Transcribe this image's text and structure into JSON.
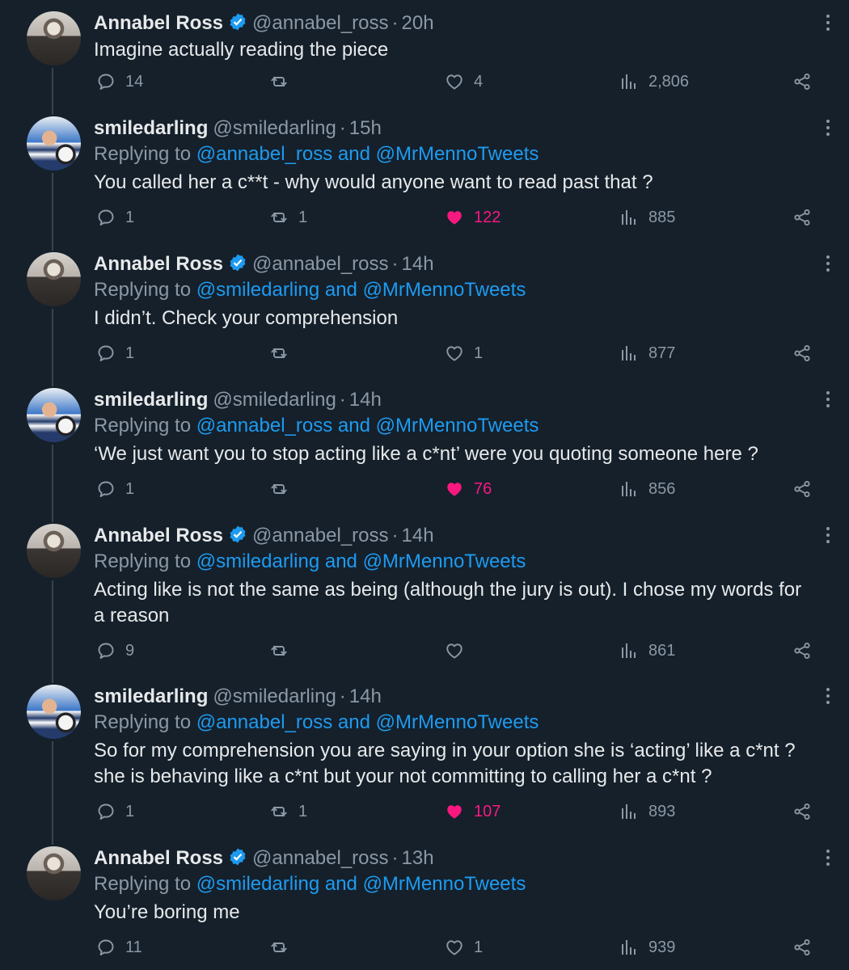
{
  "tweets": [
    {
      "name": "Annabel Ross",
      "verified": true,
      "handle": "@annabel_ross",
      "time": "20h",
      "replying_label": "",
      "replying_to": [],
      "replying_joiner": "",
      "text": [
        "Imagine actually reading the piece"
      ],
      "replies": "14",
      "retweets": "",
      "likes": "4",
      "liked": false,
      "views": "2,806",
      "avatar": "ar",
      "thread_line": "below"
    },
    {
      "name": "smiledarling",
      "verified": false,
      "handle": "@smiledarling",
      "time": "15h",
      "replying_label": "Replying to",
      "replying_to": [
        "@annabel_ross",
        "@MrMennoTweets"
      ],
      "replying_joiner": "and",
      "text": [
        "You called her a c**t - why would anyone want to read past that ?"
      ],
      "replies": "1",
      "retweets": "1",
      "likes": "122",
      "liked": true,
      "views": "885",
      "avatar": "sd",
      "thread_line": "both"
    },
    {
      "name": "Annabel Ross",
      "verified": true,
      "handle": "@annabel_ross",
      "time": "14h",
      "replying_label": "Replying to",
      "replying_to": [
        "@smiledarling",
        "@MrMennoTweets"
      ],
      "replying_joiner": "and",
      "text": [
        "I didn’t. Check your comprehension"
      ],
      "replies": "1",
      "retweets": "",
      "likes": "1",
      "liked": false,
      "views": "877",
      "avatar": "ar",
      "thread_line": "both"
    },
    {
      "name": "smiledarling",
      "verified": false,
      "handle": "@smiledarling",
      "time": "14h",
      "replying_label": "Replying to",
      "replying_to": [
        "@annabel_ross",
        "@MrMennoTweets"
      ],
      "replying_joiner": "and",
      "text": [
        "‘We just want you to stop acting like a c*nt’ were you quoting someone here ?"
      ],
      "replies": "1",
      "retweets": "",
      "likes": "76",
      "liked": true,
      "views": "856",
      "avatar": "sd",
      "thread_line": "both"
    },
    {
      "name": "Annabel Ross",
      "verified": true,
      "handle": "@annabel_ross",
      "time": "14h",
      "replying_label": "Replying to",
      "replying_to": [
        "@smiledarling",
        "@MrMennoTweets"
      ],
      "replying_joiner": "and",
      "text": [
        "Acting like is not the same as being (although the jury is out). I chose my words for",
        "a reason"
      ],
      "replies": "9",
      "retweets": "",
      "likes": "",
      "liked": false,
      "views": "861",
      "avatar": "ar",
      "thread_line": "both"
    },
    {
      "name": "smiledarling",
      "verified": false,
      "handle": "@smiledarling",
      "time": "14h",
      "replying_label": "Replying to",
      "replying_to": [
        "@annabel_ross",
        "@MrMennoTweets"
      ],
      "replying_joiner": "and",
      "text": [
        "So for my comprehension you are saying in your option she is ‘acting’ like a c*nt ?",
        "she is behaving like a c*nt but your not committing  to calling her a c*nt ?"
      ],
      "replies": "1",
      "retweets": "1",
      "likes": "107",
      "liked": true,
      "views": "893",
      "avatar": "sd",
      "thread_line": "both"
    },
    {
      "name": "Annabel Ross",
      "verified": true,
      "handle": "@annabel_ross",
      "time": "13h",
      "replying_label": "Replying to",
      "replying_to": [
        "@smiledarling",
        "@MrMennoTweets"
      ],
      "replying_joiner": "and",
      "text": [
        "You’re boring me"
      ],
      "replies": "11",
      "retweets": "",
      "likes": "1",
      "liked": false,
      "views": "939",
      "avatar": "ar",
      "thread_line": "above"
    }
  ],
  "icons": {
    "reply": "reply-icon",
    "retweet": "retweet-icon",
    "like": "heart-icon",
    "views": "views-icon",
    "share": "share-icon",
    "more": "more-icon",
    "verified": "verified-badge-icon"
  },
  "colors": {
    "background": "#15202b",
    "text": "#e7e9ea",
    "muted": "#8b98a5",
    "link": "#1d9bf0",
    "like": "#f91880",
    "line": "#38444d"
  }
}
